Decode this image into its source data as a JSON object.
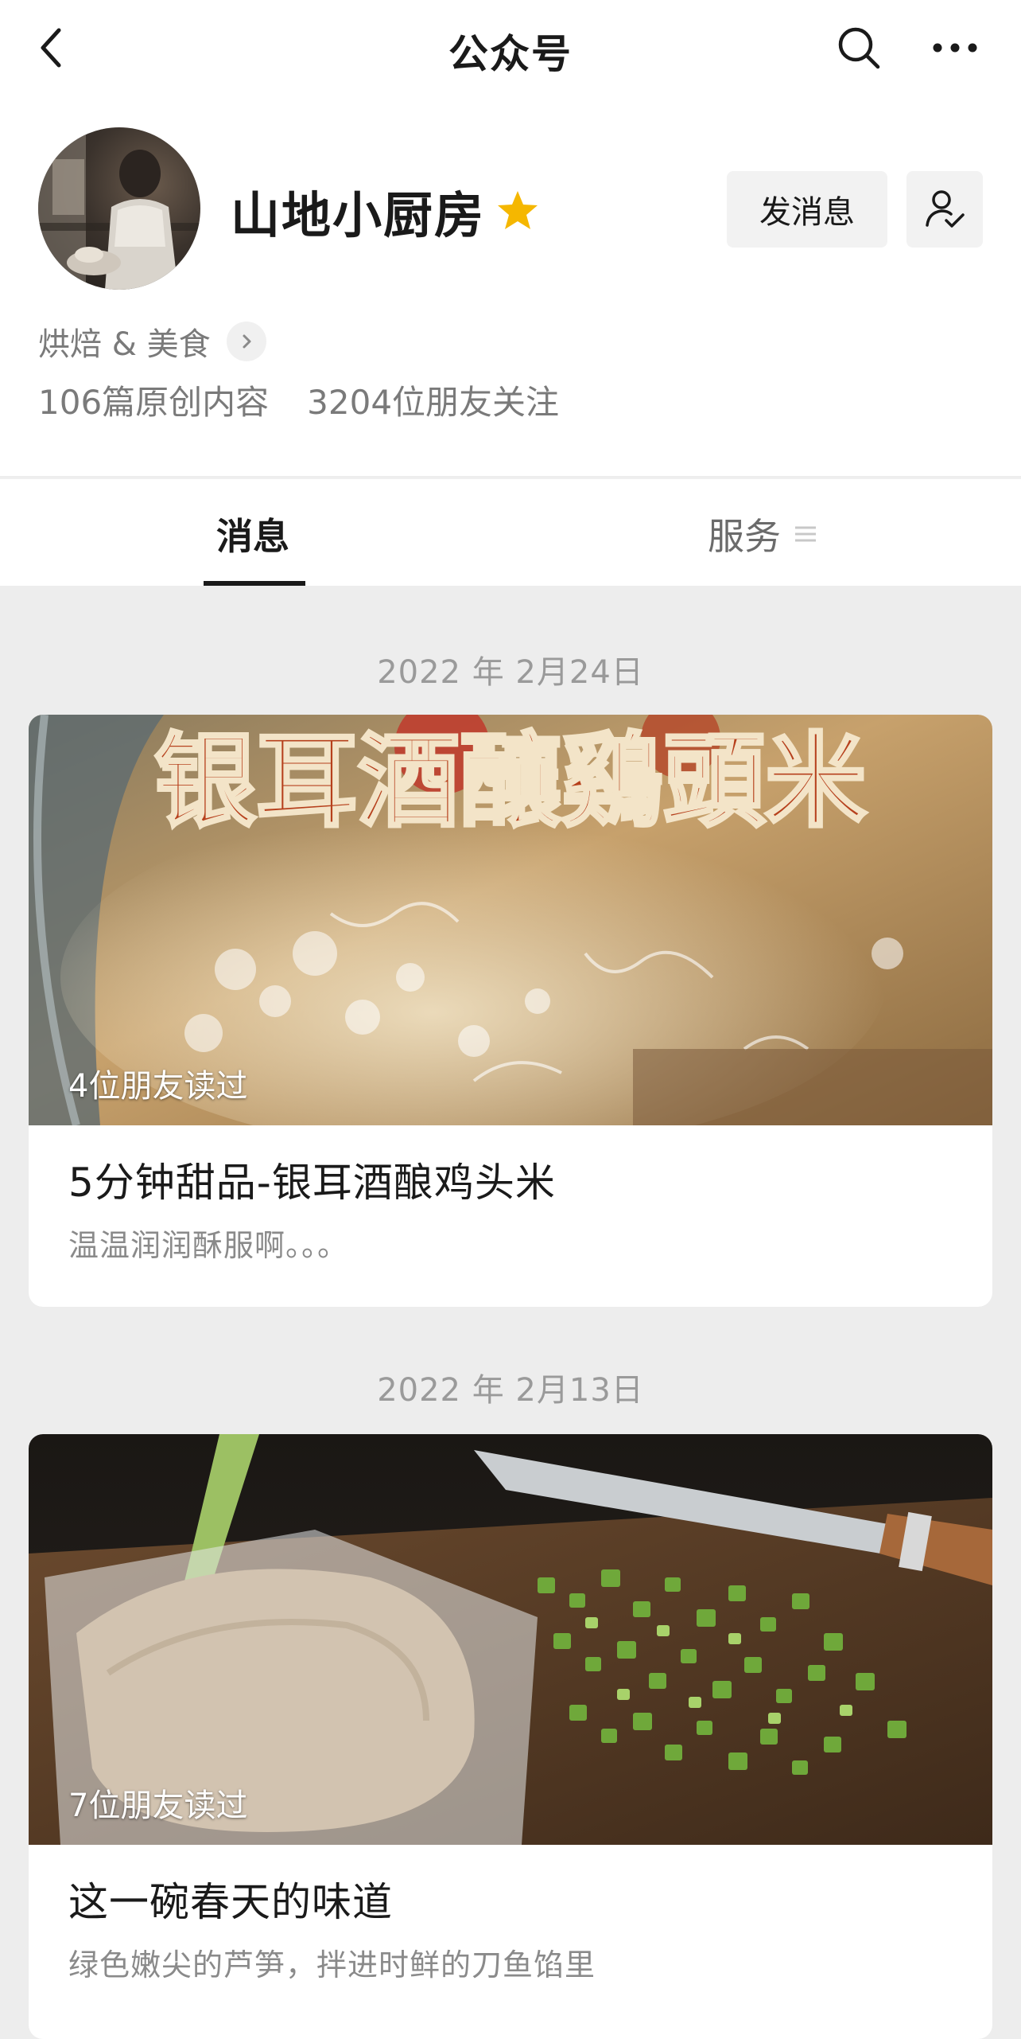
{
  "header": {
    "title": "公众号",
    "back_icon": "chevron-left-icon",
    "search_icon": "search-icon",
    "more_icon": "more-horizontal-icon"
  },
  "profile": {
    "name": "山地小厨房",
    "verified_icon": "star-icon",
    "verified_color": "#f5b700",
    "message_button": "发消息",
    "follow_icon": "user-check-icon",
    "category": "烘焙 & 美食",
    "original_count": "106篇原创内容",
    "followers": "3204位朋友关注"
  },
  "tabs": [
    {
      "label": "消息",
      "active": true
    },
    {
      "label": "服务",
      "active": false,
      "icon": "menu-icon"
    }
  ],
  "articles": [
    {
      "date": "2022 年 2月24日",
      "cover_text": "银耳酒釀鷄頭米",
      "read_count": "4位朋友读过",
      "title": "5分钟甜品-银耳酒酿鸡头米",
      "desc": "温温润润酥服啊。。。"
    },
    {
      "date": "2022 年 2月13日",
      "read_count": "7位朋友读过",
      "title": "这一碗春天的味道",
      "desc": "绿色嫩尖的芦笋，拌进时鲜的刀鱼馅里"
    }
  ]
}
